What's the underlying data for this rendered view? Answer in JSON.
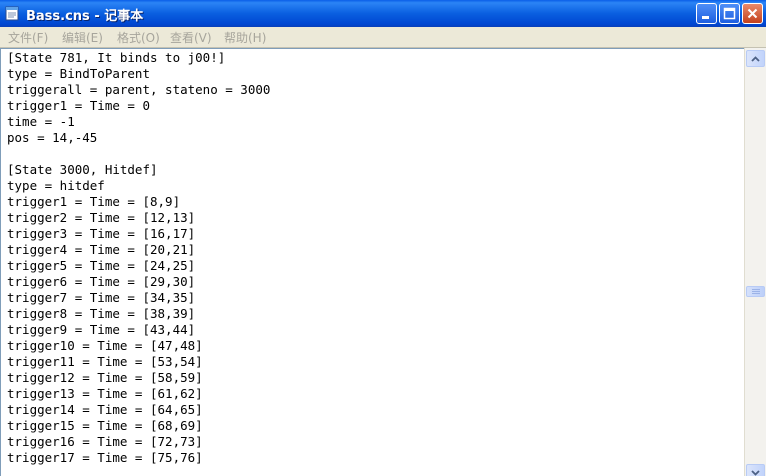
{
  "window": {
    "title": "Bass.cns - 记事本",
    "icon": "notepad-icon"
  },
  "menu": {
    "items": [
      {
        "label": "文件(F)"
      },
      {
        "label": "编辑(E)"
      },
      {
        "label": "格式(O)"
      },
      {
        "label": "查看(V)"
      },
      {
        "label": "帮助(H)"
      }
    ]
  },
  "colors": {
    "titlebar": "#0a5fe0",
    "menu_text": "#a7a59c",
    "close_button": "#c4411c"
  },
  "document": {
    "lines": [
      "[State 781, It binds to j00!]",
      "type = BindToParent",
      "triggerall = parent, stateno = 3000",
      "trigger1 = Time = 0",
      "time = -1",
      "pos = 14,-45",
      "",
      "[State 3000, Hitdef]",
      "type = hitdef",
      "trigger1 = Time = [8,9]",
      "trigger2 = Time = [12,13]",
      "trigger3 = Time = [16,17]",
      "trigger4 = Time = [20,21]",
      "trigger5 = Time = [24,25]",
      "trigger6 = Time = [29,30]",
      "trigger7 = Time = [34,35]",
      "trigger8 = Time = [38,39]",
      "trigger9 = Time = [43,44]",
      "trigger10 = Time = [47,48]",
      "trigger11 = Time = [53,54]",
      "trigger12 = Time = [58,59]",
      "trigger13 = Time = [61,62]",
      "trigger14 = Time = [64,65]",
      "trigger15 = Time = [68,69]",
      "trigger16 = Time = [72,73]",
      "trigger17 = Time = [75,76]"
    ]
  }
}
